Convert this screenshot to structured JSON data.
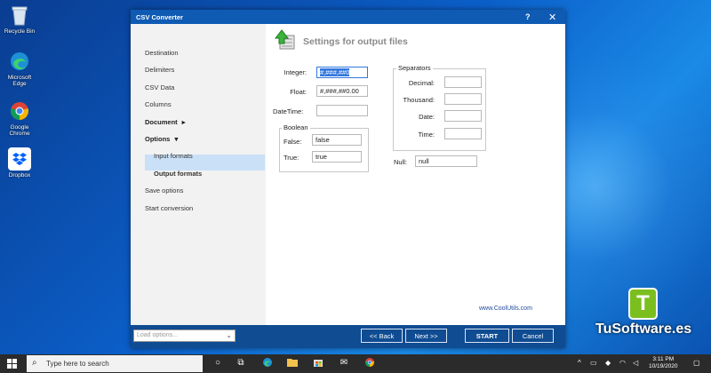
{
  "desktop": {
    "icons": [
      {
        "name": "recycle-bin",
        "label": "Recycle Bin"
      },
      {
        "name": "microsoft-edge",
        "label": "Microsoft Edge"
      },
      {
        "name": "google-chrome",
        "label": "Google Chrome"
      },
      {
        "name": "dropbox",
        "label": "Dropbox"
      }
    ]
  },
  "window": {
    "title": "CSV Converter",
    "help": "?",
    "close": "✕"
  },
  "sidebar": {
    "items": [
      {
        "label": "Destination"
      },
      {
        "label": "Delimiters"
      },
      {
        "label": "CSV Data"
      },
      {
        "label": "Columns"
      },
      {
        "label": "Document"
      },
      {
        "label": "Options"
      },
      {
        "label": "Input formats"
      },
      {
        "label": "Output formats"
      },
      {
        "label": "Save options"
      },
      {
        "label": "Start conversion"
      }
    ],
    "active": "Output formats"
  },
  "header": {
    "title": "Settings for output files"
  },
  "form": {
    "integer_label": "Integer:",
    "integer_value": "#,###,##0",
    "float_label": "Float:",
    "float_value": "#,###,##0.00",
    "datetime_label": "DateTime:",
    "datetime_value": "",
    "boolean_group": "Boolean",
    "false_label": "False:",
    "false_value": "false",
    "true_label": "True:",
    "true_value": "true",
    "separators_group": "Separators",
    "decimal_label": "Decimal:",
    "thousand_label": "Thousand:",
    "date_label": "Date:",
    "time_label": "Time:",
    "null_label": "Null:",
    "null_value": "null"
  },
  "link": "www.CoolUtils.com",
  "footer": {
    "load_placeholder": "Load options...",
    "back": "<< Back",
    "next": "Next >>",
    "start": "START",
    "cancel": "Cancel"
  },
  "watermark": {
    "letter": "T",
    "text": "TuSoftware.es"
  },
  "taskbar": {
    "search_placeholder": "Type here to search",
    "time": "3:11 PM",
    "date": "10/19/2020"
  }
}
